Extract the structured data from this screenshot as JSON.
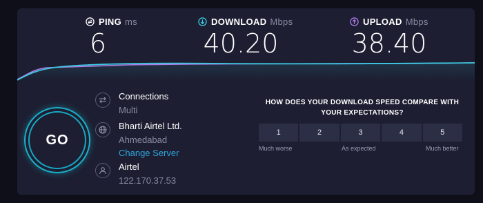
{
  "metrics": {
    "ping": {
      "label": "PING",
      "unit": "ms",
      "value": "6",
      "icon": "ping-icon",
      "color": "#ffffff"
    },
    "download": {
      "label": "DOWNLOAD",
      "unit": "Mbps",
      "value": "40.20",
      "icon": "download-arrow-icon",
      "color": "#3bc8e0"
    },
    "upload": {
      "label": "UPLOAD",
      "unit": "Mbps",
      "value": "38.40",
      "icon": "upload-arrow-icon",
      "color": "#b07be8"
    }
  },
  "go_button": {
    "label": "GO"
  },
  "connections": {
    "label": "Connections",
    "value": "Multi",
    "icon": "connections-icon"
  },
  "server": {
    "provider": "Bharti Airtel Ltd.",
    "location": "Ahmedabad",
    "change_label": "Change Server",
    "icon": "globe-icon"
  },
  "user": {
    "isp": "Airtel",
    "ip": "122.170.37.53",
    "icon": "user-icon"
  },
  "feedback": {
    "question": "HOW DOES YOUR DOWNLOAD SPEED COMPARE WITH YOUR EXPECTATIONS?",
    "ratings": [
      "1",
      "2",
      "3",
      "4",
      "5"
    ],
    "scale_low": "Much worse",
    "scale_mid": "As expected",
    "scale_high": "Much better"
  },
  "colors": {
    "card": "#1d1e31",
    "accent": "#1ab0c8",
    "download": "#3bc8e0",
    "upload": "#b07be8",
    "muted": "#8a8ca3"
  }
}
